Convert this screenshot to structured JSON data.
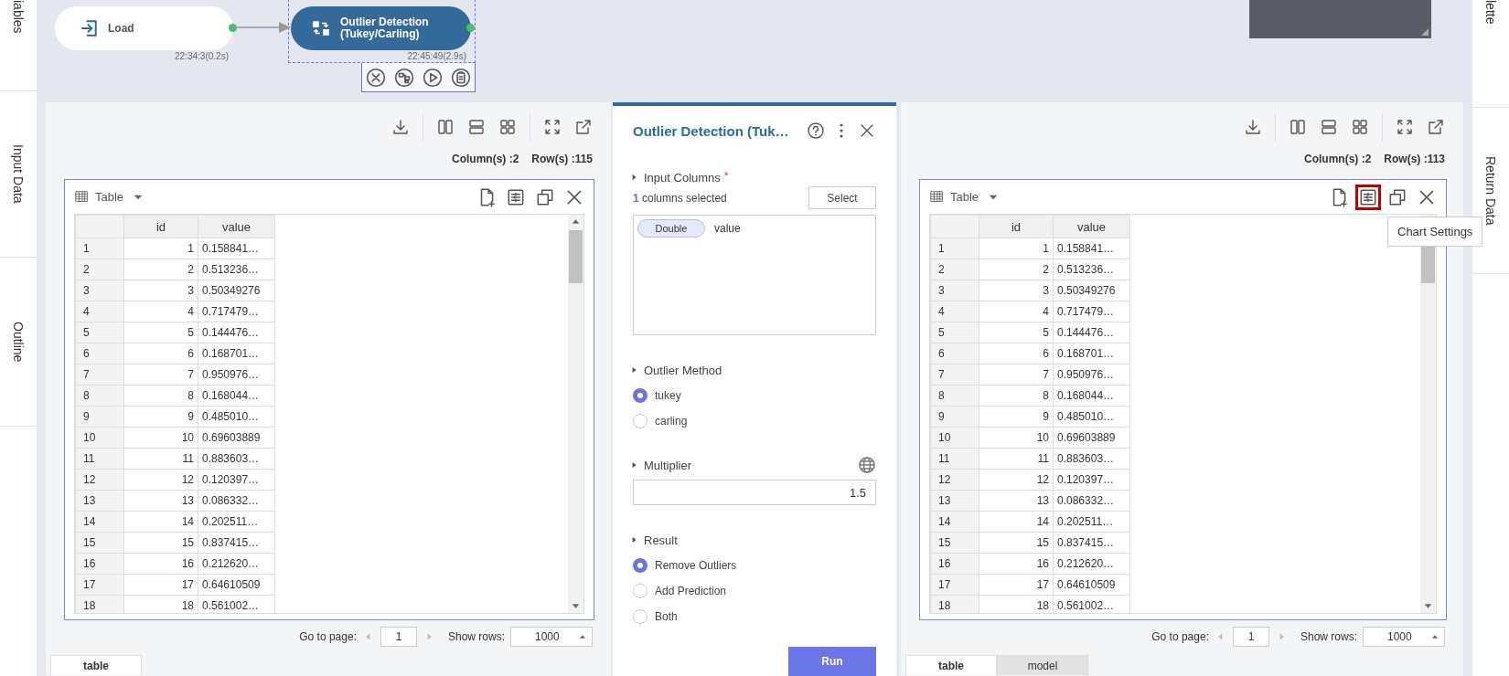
{
  "left_sidebar": {
    "tabs": [
      {
        "label": "iables"
      },
      {
        "label": "Input Data"
      },
      {
        "label": "Outline"
      }
    ]
  },
  "workflow": {
    "nodes": [
      {
        "kind": "load",
        "label_lines": [
          "Load"
        ],
        "time": "22:34:3(0.2s)",
        "selected": false
      },
      {
        "kind": "outlier",
        "label_lines": [
          "Outlier Detection",
          "(Tukey/Carling)"
        ],
        "time": "22:45:49(2.9s)",
        "selected": true
      }
    ]
  },
  "data_panels": [
    {
      "column_count": "Column(s) :2",
      "row_count": "Row(s) :115",
      "view": "Table",
      "columns": [
        "",
        "id",
        "value"
      ],
      "rows": [
        [
          "1",
          "1",
          "0.158841…"
        ],
        [
          "2",
          "2",
          "0.513236…"
        ],
        [
          "3",
          "3",
          "0.50349276"
        ],
        [
          "4",
          "4",
          "0.717479…"
        ],
        [
          "5",
          "5",
          "0.144476…"
        ],
        [
          "6",
          "6",
          "0.168701…"
        ],
        [
          "7",
          "7",
          "0.950976…"
        ],
        [
          "8",
          "8",
          "0.168044…"
        ],
        [
          "9",
          "9",
          "0.485010…"
        ],
        [
          "10",
          "10",
          "0.69603889"
        ],
        [
          "11",
          "11",
          "0.883603…"
        ],
        [
          "12",
          "12",
          "0.120397…"
        ],
        [
          "13",
          "13",
          "0.086332…"
        ],
        [
          "14",
          "14",
          "0.202511…"
        ],
        [
          "15",
          "15",
          "0.837415…"
        ],
        [
          "16",
          "16",
          "0.212620…"
        ],
        [
          "17",
          "17",
          "0.64610509"
        ],
        [
          "18",
          "18",
          "0.561002…"
        ]
      ],
      "chart_settings_highlighted": false,
      "pager": {
        "page_label": "Go to page:",
        "page": "1",
        "rows_label": "Show rows:",
        "rows": "1000"
      },
      "tabs": [
        {
          "label": "table",
          "selected": true
        }
      ]
    },
    {
      "column_count": "Column(s) :2",
      "row_count": "Row(s) :113",
      "view": "Table",
      "columns": [
        "",
        "id",
        "value"
      ],
      "rows": [
        [
          "1",
          "1",
          "0.158841…"
        ],
        [
          "2",
          "2",
          "0.513236…"
        ],
        [
          "3",
          "3",
          "0.50349276"
        ],
        [
          "4",
          "4",
          "0.717479…"
        ],
        [
          "5",
          "5",
          "0.144476…"
        ],
        [
          "6",
          "6",
          "0.168701…"
        ],
        [
          "7",
          "7",
          "0.950976…"
        ],
        [
          "8",
          "8",
          "0.168044…"
        ],
        [
          "9",
          "9",
          "0.485010…"
        ],
        [
          "10",
          "10",
          "0.69603889"
        ],
        [
          "11",
          "11",
          "0.883603…"
        ],
        [
          "12",
          "12",
          "0.120397…"
        ],
        [
          "13",
          "13",
          "0.086332…"
        ],
        [
          "14",
          "14",
          "0.202511…"
        ],
        [
          "15",
          "15",
          "0.837415…"
        ],
        [
          "16",
          "16",
          "0.212620…"
        ],
        [
          "17",
          "17",
          "0.64610509"
        ],
        [
          "18",
          "18",
          "0.561002…"
        ]
      ],
      "chart_settings_highlighted": true,
      "tooltip": "Chart Settings",
      "pager": {
        "page_label": "Go to page:",
        "page": "1",
        "rows_label": "Show rows:",
        "rows": "1000"
      },
      "tabs": [
        {
          "label": "table",
          "selected": true
        },
        {
          "label": "model",
          "selected": false
        }
      ]
    }
  ],
  "settings": {
    "title": "Outlier Detection (Tuk…",
    "sections": [
      {
        "kind": "columns",
        "label": "Input Columns",
        "required_mark": "*",
        "count": "1",
        "count_text": "columns selected",
        "button": "Select",
        "items": [
          {
            "type": "Double",
            "name": "value"
          }
        ]
      },
      {
        "kind": "radio",
        "label": "Outlier Method",
        "options": [
          {
            "label": "tukey",
            "selected": true
          },
          {
            "label": "carling",
            "selected": false
          }
        ]
      },
      {
        "kind": "number",
        "label": "Multiplier",
        "value": "1.5"
      },
      {
        "kind": "radio",
        "label": "Result",
        "options": [
          {
            "label": "Remove Outliers",
            "selected": true
          },
          {
            "label": "Add Prediction",
            "selected": false
          },
          {
            "label": "Both",
            "selected": false
          }
        ]
      }
    ],
    "run_button": "Run"
  },
  "right_sidebar": {
    "tabs": [
      {
        "label": "lette"
      },
      {
        "label": "Return Data"
      }
    ]
  }
}
